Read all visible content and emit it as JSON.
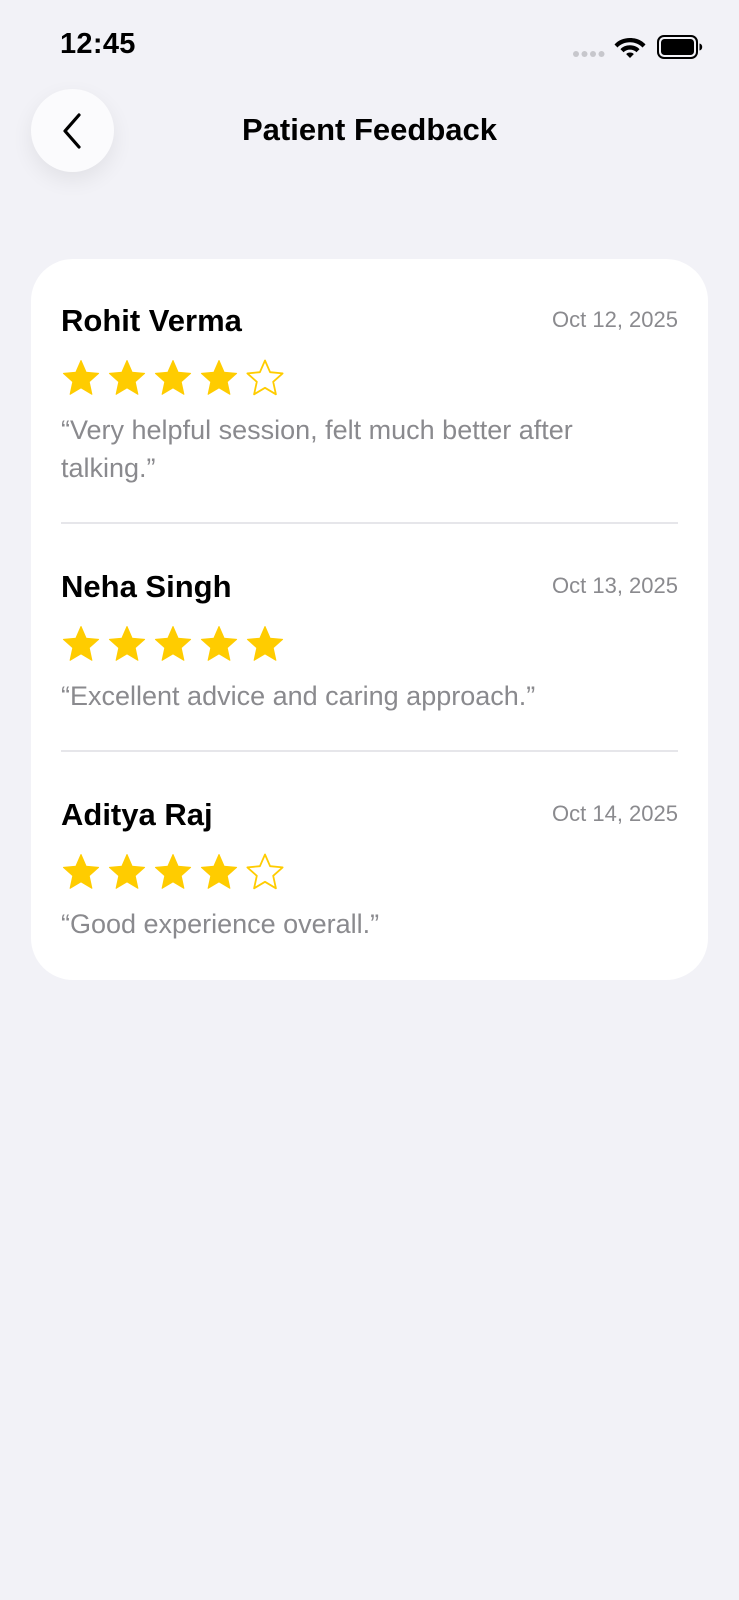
{
  "status_bar": {
    "time": "12:45"
  },
  "header": {
    "title": "Patient Feedback",
    "back_icon": "chevron-left-icon"
  },
  "colors": {
    "background": "#f2f2f7",
    "card": "#ffffff",
    "star": "#ffcc00",
    "secondary_text": "#8a8a8e"
  },
  "reviews": [
    {
      "name": "Rohit Verma",
      "date": "Oct 12, 2025",
      "rating": 4,
      "max_rating": 5,
      "comment": "“Very helpful session, felt much better after talking.”"
    },
    {
      "name": "Neha Singh",
      "date": "Oct 13, 2025",
      "rating": 5,
      "max_rating": 5,
      "comment": "“Excellent advice and caring approach.”"
    },
    {
      "name": "Aditya Raj",
      "date": "Oct 14, 2025",
      "rating": 4,
      "max_rating": 5,
      "comment": "“Good experience overall.”"
    }
  ]
}
